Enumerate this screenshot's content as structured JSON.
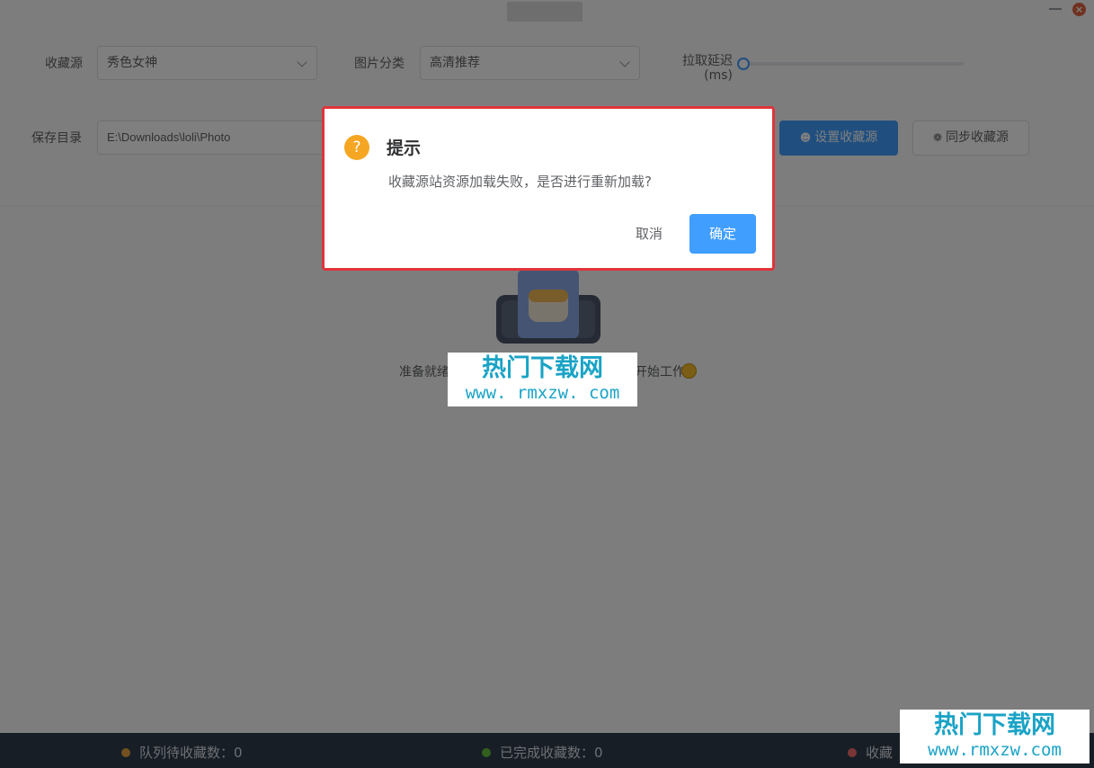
{
  "form": {
    "source_label": "收藏源",
    "source_value": "秀色女神",
    "category_label": "图片分类",
    "category_value": "高清推荐",
    "delay_label": "拉取延迟",
    "delay_unit": "(ms)",
    "delay_value": 0,
    "save_dir_label": "保存目录",
    "save_dir_value": "E:\\Downloads\\loli\\Photo"
  },
  "buttons": {
    "set_source": "设置收藏源",
    "sync_source": "同步收藏源"
  },
  "empty_state": {
    "text_start": "准备就绪",
    "text_end": "开始工作"
  },
  "status_bar": {
    "queue_label": "队列待收藏数：0",
    "done_label": "已完成收藏数：0",
    "third_label": "收藏",
    "colors": {
      "queue": "#e6a23c",
      "done": "#67c23a",
      "third": "#f56c6c"
    }
  },
  "dialog": {
    "title": "提示",
    "message": "收藏源站资源加载失败，是否进行重新加载?",
    "cancel": "取消",
    "ok": "确定",
    "icon": "question-icon"
  },
  "watermark": {
    "brand": "热门下载网",
    "url": "www. rmxzw. com",
    "url_corner": "www.rmxzw.com"
  }
}
